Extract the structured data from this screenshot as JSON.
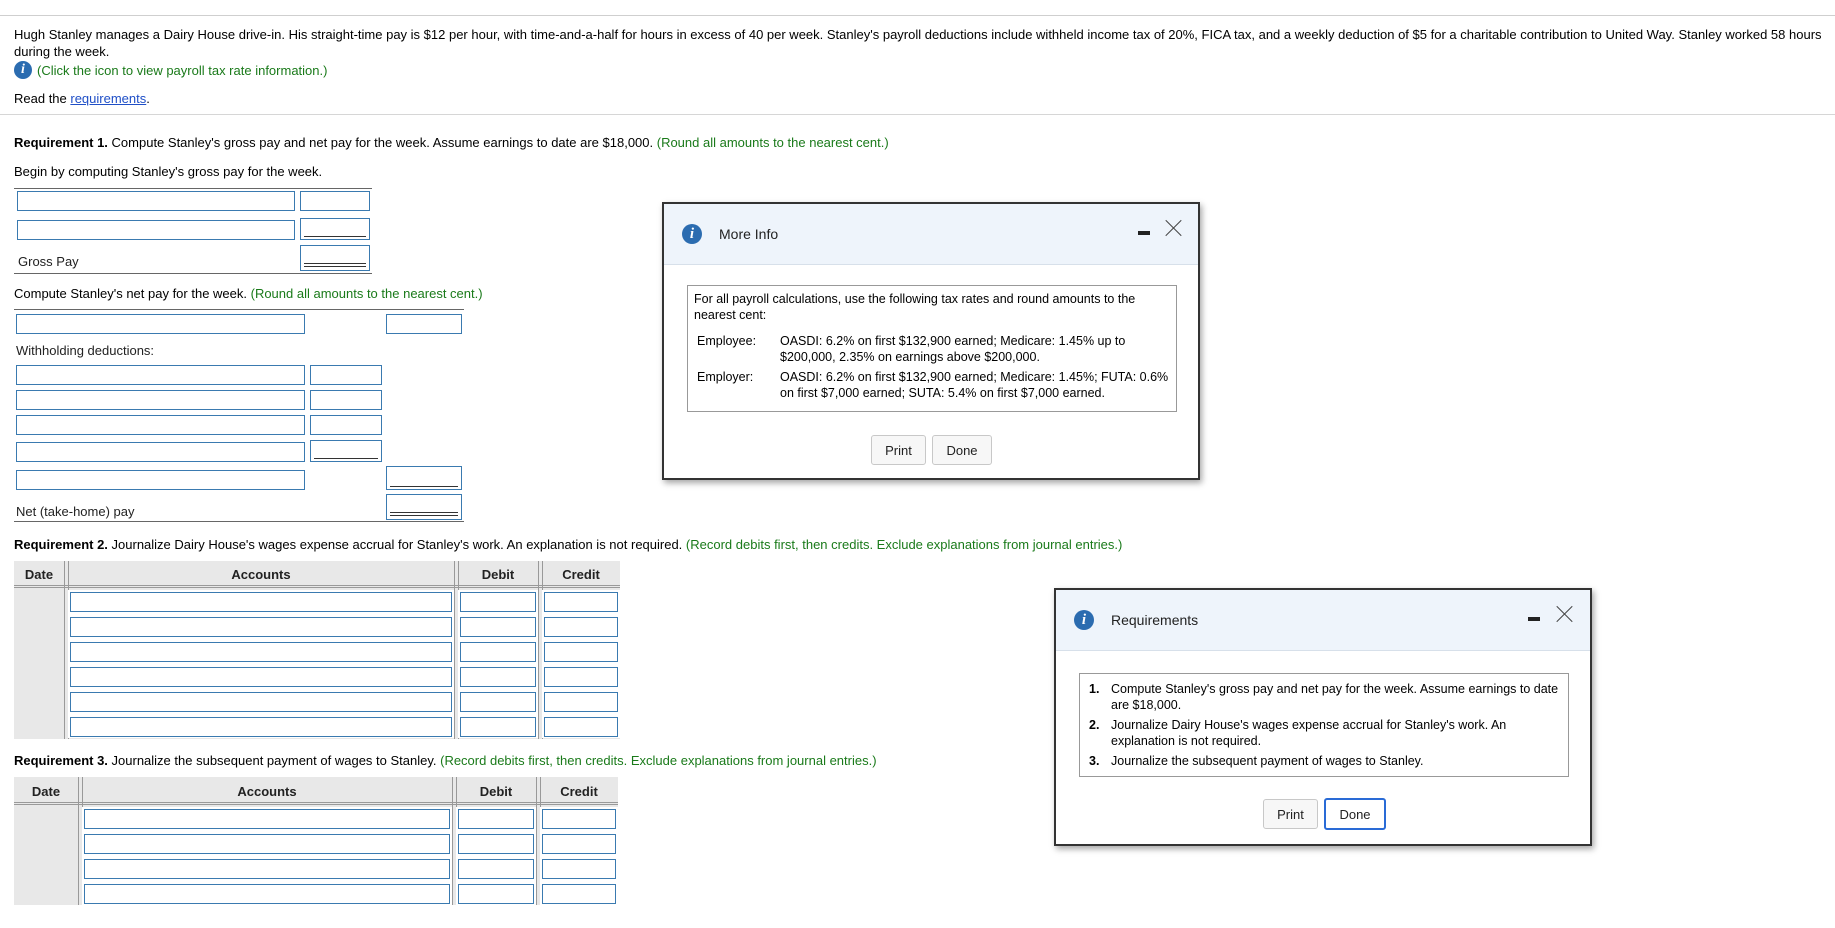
{
  "problem": {
    "text": "Hugh Stanley manages a Dairy House drive-in. His straight-time pay is $12 per hour, with time-and-a-half for hours in excess of 40 per week. Stanley's payroll deductions include withheld income tax of 20%, FICA tax, and a weekly deduction of $5 for a charitable contribution to United Way. Stanley worked 58 hours during the week.",
    "info_link": "(Click the icon to view payroll tax rate information.)",
    "read_prefix": "Read the ",
    "read_link": "requirements",
    "read_suffix": "."
  },
  "req1": {
    "label": "Requirement 1.",
    "text": " Compute Stanley's gross pay and net pay for the week. Assume earnings to date are $18,000. ",
    "hint": "(Round all amounts to the nearest cent.)",
    "begin": "Begin by computing Stanley's gross pay for the week.",
    "gross_pay_label": "Gross Pay",
    "net_text": "Compute Stanley's net pay for the week. ",
    "net_hint": "(Round all amounts to the nearest cent.)",
    "withholding_label": "Withholding deductions:",
    "net_label": "Net (take-home) pay"
  },
  "req2": {
    "label": "Requirement 2.",
    "text": " Journalize Dairy House's wages expense accrual for Stanley's work. An explanation is not required. ",
    "hint": "(Record debits first, then credits. Exclude explanations from journal entries.)"
  },
  "req3": {
    "label": "Requirement 3.",
    "text": " Journalize the subsequent payment of wages to Stanley. ",
    "hint": "(Record debits first, then credits. Exclude explanations from journal entries.)"
  },
  "journal_headers": {
    "date": "Date",
    "accounts": "Accounts",
    "debit": "Debit",
    "credit": "Credit"
  },
  "more_info": {
    "title": "More Info",
    "intro": "For all payroll calculations, use the following tax rates and round amounts to the nearest cent:",
    "employee_label": "Employee:",
    "employee_text": "OASDI: 6.2% on first $132,900 earned; Medicare: 1.45% up to $200,000, 2.35% on earnings above $200,000.",
    "employer_label": "Employer:",
    "employer_text": "OASDI: 6.2% on first $132,900 earned; Medicare: 1.45%; FUTA: 0.6% on first $7,000 earned; SUTA: 5.4% on first $7,000 earned.",
    "print": "Print",
    "done": "Done"
  },
  "requirements_dialog": {
    "title": "Requirements",
    "items": [
      {
        "num": "1.",
        "text": "Compute Stanley's gross pay and net pay for the week. Assume earnings to date are $18,000."
      },
      {
        "num": "2.",
        "text": "Journalize Dairy House's wages expense accrual for Stanley's work. An explanation is not required."
      },
      {
        "num": "3.",
        "text": "Journalize the subsequent payment of wages to Stanley."
      }
    ],
    "print": "Print",
    "done": "Done"
  },
  "colors": {
    "accent": "#2b6cb0",
    "hint_green": "#1a7a1a",
    "input_border": "#3a7ab0"
  },
  "icons": {
    "info": "info-icon",
    "minimize": "minimize-icon",
    "close": "close-icon"
  }
}
